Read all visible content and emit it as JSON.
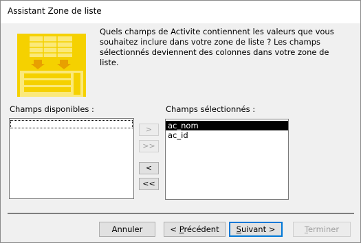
{
  "window": {
    "title": "Assistant Zone de liste"
  },
  "description": "Quels champs de Activite contiennent les valeurs que vous souhaitez inclure dans votre zone de liste ? Les champs sélectionnés deviennent des colonnes dans votre zone de liste.",
  "available": {
    "label": "Champs disponibles :",
    "items": []
  },
  "selected": {
    "label": "Champs sélectionnés :",
    "items": [
      {
        "text": "ac_nom"
      },
      {
        "text": "ac_id"
      }
    ]
  },
  "move_buttons": {
    "add_one": ">",
    "add_all": ">>",
    "remove_one": "<",
    "remove_all": "<<"
  },
  "buttons": {
    "cancel": "Annuler",
    "back_arrow": "< ",
    "back_acc": "P",
    "back_rest": "récédent",
    "next_acc": "S",
    "next_rest": "uivant >",
    "finish_acc": "T",
    "finish_rest": "erminer"
  },
  "colors": {
    "illustration": "#f5d100",
    "illustration_light": "#fbe97a",
    "focus_blue": "#0078d7"
  }
}
